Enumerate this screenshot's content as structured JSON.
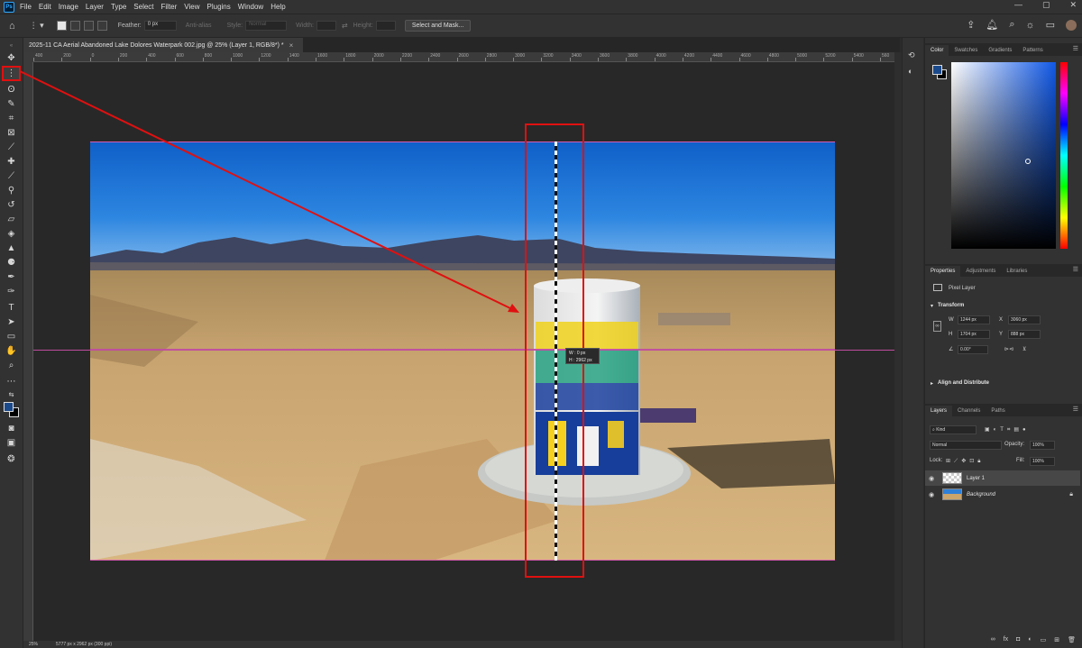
{
  "menu": {
    "logo": "Ps",
    "items": [
      "File",
      "Edit",
      "Image",
      "Layer",
      "Type",
      "Select",
      "Filter",
      "View",
      "Plugins",
      "Window",
      "Help"
    ],
    "window_controls": [
      "—",
      "▢",
      "✕"
    ]
  },
  "options": {
    "feather_label": "Feather:",
    "feather_value": "0 px",
    "antialias_label": "Anti-alias",
    "style_label": "Style:",
    "style_value": "Normal",
    "width_label": "Width:",
    "height_label": "Height:",
    "select_mask_label": "Select and Mask..."
  },
  "document": {
    "tab_title": "2025-11 CA Aerial Abandoned Lake Dolores Waterpark 002.jpg @ 25% (Layer 1, RGB/8*) *",
    "close": "×"
  },
  "ruler": {
    "h_labels": [
      "400",
      "200",
      "0",
      "200",
      "400",
      "600",
      "800",
      "1000",
      "1200",
      "1400",
      "1600",
      "1800",
      "2000",
      "2200",
      "2400",
      "2600",
      "2800",
      "3000",
      "3200",
      "3400",
      "3600",
      "3800",
      "4000",
      "4200",
      "4400",
      "4600",
      "4800",
      "5000",
      "5200",
      "5400",
      "560"
    ]
  },
  "selection_info": {
    "w": "W : 0 px",
    "h": "H : 2962 px"
  },
  "color_panel": {
    "tabs": [
      "Color",
      "Swatches",
      "Gradients",
      "Patterns"
    ],
    "foreground": "#1b4a8c",
    "background": "#000000"
  },
  "properties": {
    "tabs": [
      "Properties",
      "Adjustments",
      "Libraries"
    ],
    "layer_type": "Pixel Layer",
    "transform_label": "Transform",
    "w": "1244 px",
    "h": "1704 px",
    "x": "3060 px",
    "y": "888 px",
    "angle": "0.00°",
    "align_label": "Align and Distribute"
  },
  "layers": {
    "tabs": [
      "Layers",
      "Channels",
      "Paths"
    ],
    "kind": "Kind",
    "blend_mode": "Normal",
    "opacity_label": "Opacity:",
    "opacity": "100%",
    "lock_label": "Lock:",
    "fill_label": "Fill:",
    "fill": "100%",
    "items": [
      {
        "name": "Layer 1",
        "selected": true
      },
      {
        "name": "Background",
        "selected": false
      }
    ]
  },
  "status": {
    "zoom": "25%",
    "dims": "5777 px x 2962 px (300 ppi)"
  }
}
